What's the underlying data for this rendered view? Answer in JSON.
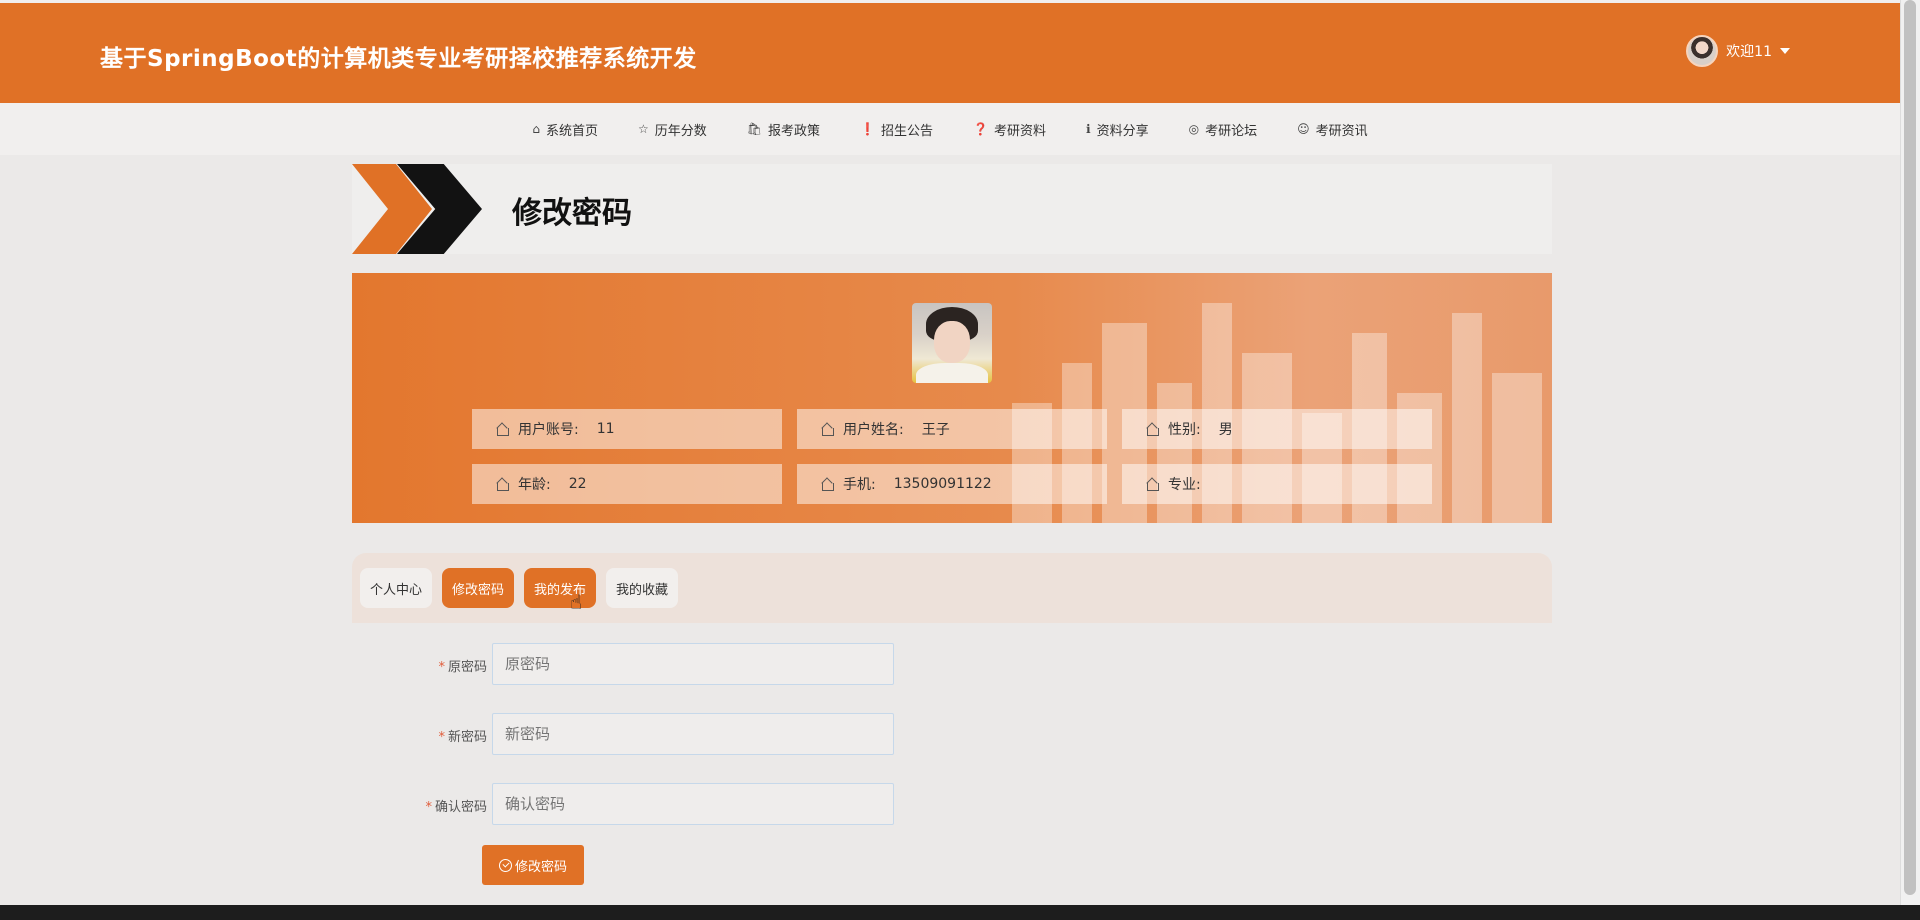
{
  "header": {
    "title": "基于SpringBoot的计算机类专业考研择校推荐系统开发",
    "welcome": "欢迎11"
  },
  "nav": [
    {
      "icon": "home-icon",
      "glyph": "⌂",
      "label": "系统首页"
    },
    {
      "icon": "star-icon",
      "glyph": "☆",
      "label": "历年分数"
    },
    {
      "icon": "bag-icon",
      "glyph": "🛍",
      "label": "报考政策"
    },
    {
      "icon": "alert-icon",
      "glyph": "❗",
      "label": "招生公告"
    },
    {
      "icon": "question-icon",
      "glyph": "❓",
      "label": "考研资料"
    },
    {
      "icon": "info-icon",
      "glyph": "ℹ",
      "label": "资料分享"
    },
    {
      "icon": "globe-icon",
      "glyph": "◎",
      "label": "考研论坛"
    },
    {
      "icon": "smile-icon",
      "glyph": "☺",
      "label": "考研资讯"
    }
  ],
  "page": {
    "title": "修改密码"
  },
  "profile": {
    "account_label": "用户账号:",
    "account_value": "11",
    "name_label": "用户姓名:",
    "name_value": "王子",
    "gender_label": "性别:",
    "gender_value": "男",
    "age_label": "年龄:",
    "age_value": "22",
    "phone_label": "手机:",
    "phone_value": "13509091122",
    "major_label": "专业:",
    "major_value": ""
  },
  "tabs": [
    "个人中心",
    "修改密码",
    "我的发布",
    "我的收藏"
  ],
  "form": {
    "old_label": "原密码",
    "old_placeholder": "原密码",
    "new_label": "新密码",
    "new_placeholder": "新密码",
    "confirm_label": "确认密码",
    "confirm_placeholder": "确认密码",
    "submit_label": "修改密码"
  },
  "colors": {
    "accent": "#e07126",
    "dark": "#121212"
  }
}
